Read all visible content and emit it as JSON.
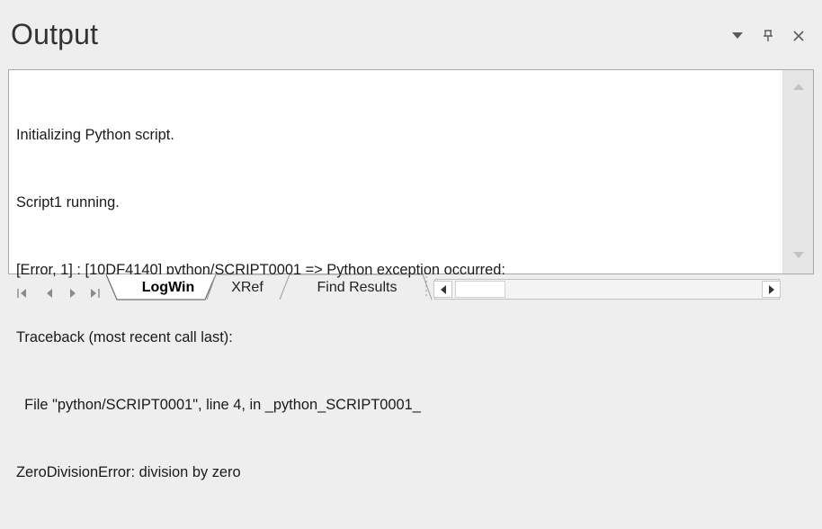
{
  "panel": {
    "title": "Output"
  },
  "header": {
    "icons": [
      "dropdown-arrow-icon",
      "pin-icon",
      "close-icon"
    ]
  },
  "log": {
    "lines": [
      "Initializing Python script.",
      "Script1 running.",
      "[Error, 1] : [10DF4140] python/SCRIPT0001 => Python exception occurred:",
      "Traceback (most recent call last):",
      "  File \"python/SCRIPT0001\", line 4, in _python_SCRIPT0001_",
      "ZeroDivisionError: division by zero"
    ]
  },
  "tabs": {
    "items": [
      {
        "label": "LogWin",
        "active": true
      },
      {
        "label": "XRef",
        "active": false
      },
      {
        "label": "Find Results",
        "active": false
      }
    ]
  },
  "colors": {
    "background": "#eeeeee",
    "content_bg": "#ffffff",
    "text": "#1a1a1a",
    "title": "#333333",
    "scrollbar": "#e6e6e6"
  }
}
